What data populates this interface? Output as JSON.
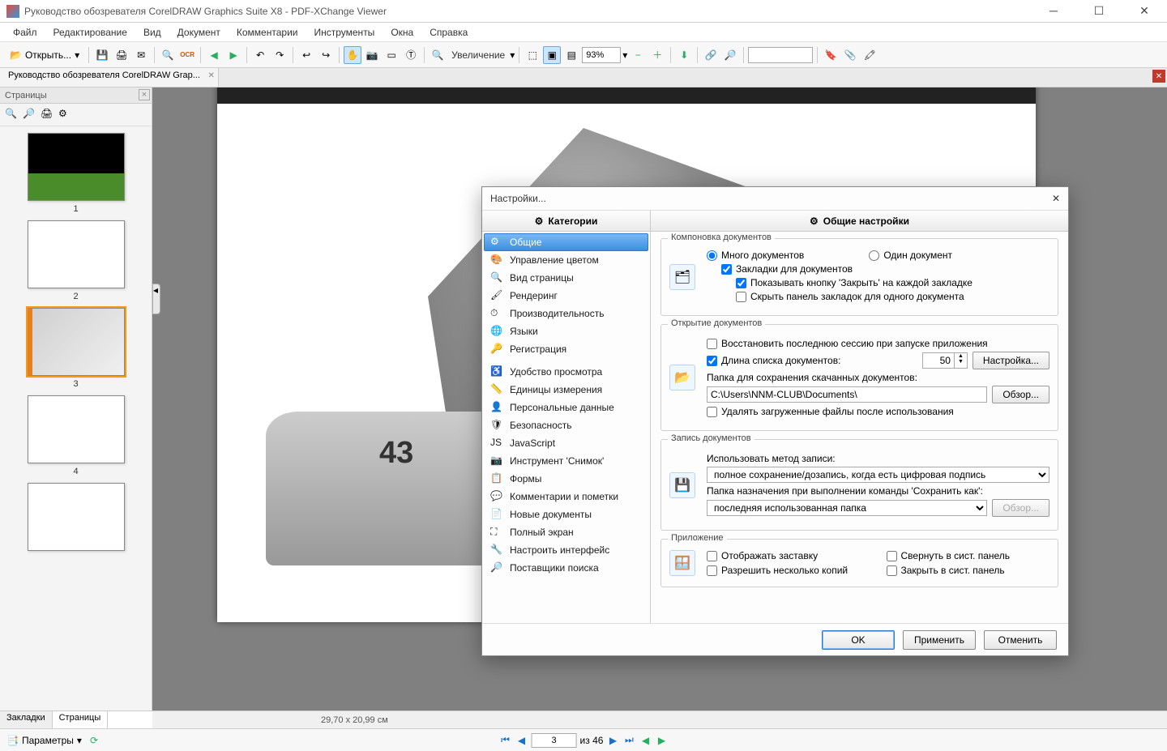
{
  "window": {
    "title": "Руководство обозревателя CorelDRAW Graphics Suite X8 - PDF-XChange Viewer"
  },
  "menu": [
    "Файл",
    "Редактирование",
    "Вид",
    "Документ",
    "Комментарии",
    "Инструменты",
    "Окна",
    "Справка"
  ],
  "toolbar": {
    "open_label": "Открыть...",
    "zoom_label": "Увеличение",
    "zoom_value": "93%"
  },
  "doc_tab": "Руководство обозревателя CorelDRAW Grap...",
  "side": {
    "title": "Страницы",
    "thumbs": [
      "1",
      "2",
      "3",
      "4"
    ],
    "bottom_tabs": [
      "Закладки",
      "Страницы"
    ]
  },
  "status": {
    "coord": "29,70 x 20,99 см"
  },
  "pager": {
    "params_label": "Параметры",
    "page_value": "3",
    "of_label": "из 46"
  },
  "art": {
    "car_number": "43"
  },
  "dialog": {
    "title": "Настройки...",
    "categories_header": "Категории",
    "options_header": "Общие настройки",
    "categories": [
      "Общие",
      "Управление цветом",
      "Вид страницы",
      "Рендеринг",
      "Производительность",
      "Языки",
      "Регистрация",
      "Удобство просмотра",
      "Единицы измерения",
      "Персональные данные",
      "Безопасность",
      "JavaScript",
      "Инструмент 'Снимок'",
      "Формы",
      "Комментарии и пометки",
      "Новые документы",
      "Полный экран",
      "Настроить интерфейс",
      "Поставщики поиска"
    ],
    "group_docs_layout": "Компоновка документов",
    "radio_multi": "Много документов",
    "radio_single": "Один документ",
    "chk_tabs": "Закладки для документов",
    "chk_show_close": "Показывать кнопку 'Закрыть' на каждой закладке",
    "chk_hide_single": "Скрыть панель закладок для одного документа",
    "group_open": "Открытие документов",
    "chk_restore": "Восстановить последнюю сессию при запуске приложения",
    "chk_list_len": "Длина списка документов:",
    "list_len_value": "50",
    "btn_config": "Настройка...",
    "lbl_download_folder": "Папка для сохранения скачанных документов:",
    "download_folder_value": "C:\\Users\\NNM-CLUB\\Documents\\",
    "btn_browse": "Обзор...",
    "chk_delete_after": "Удалять загруженные файлы после использования",
    "group_save": "Запись документов",
    "lbl_save_method": "Использовать метод записи:",
    "save_method_value": "полное сохранение/дозапись, когда есть цифровая подпись",
    "lbl_saveas_folder": "Папка назначения при выполнении команды 'Сохранить как':",
    "saveas_folder_value": "последняя использованная папка",
    "group_app": "Приложение",
    "chk_splash": "Отображать заставку",
    "chk_multi_copies": "Разрешить несколько копий",
    "chk_minimize_tray": "Свернуть в сист. панель",
    "chk_close_tray": "Закрыть в сист. панель",
    "btn_ok": "OK",
    "btn_apply": "Применить",
    "btn_cancel": "Отменить"
  }
}
